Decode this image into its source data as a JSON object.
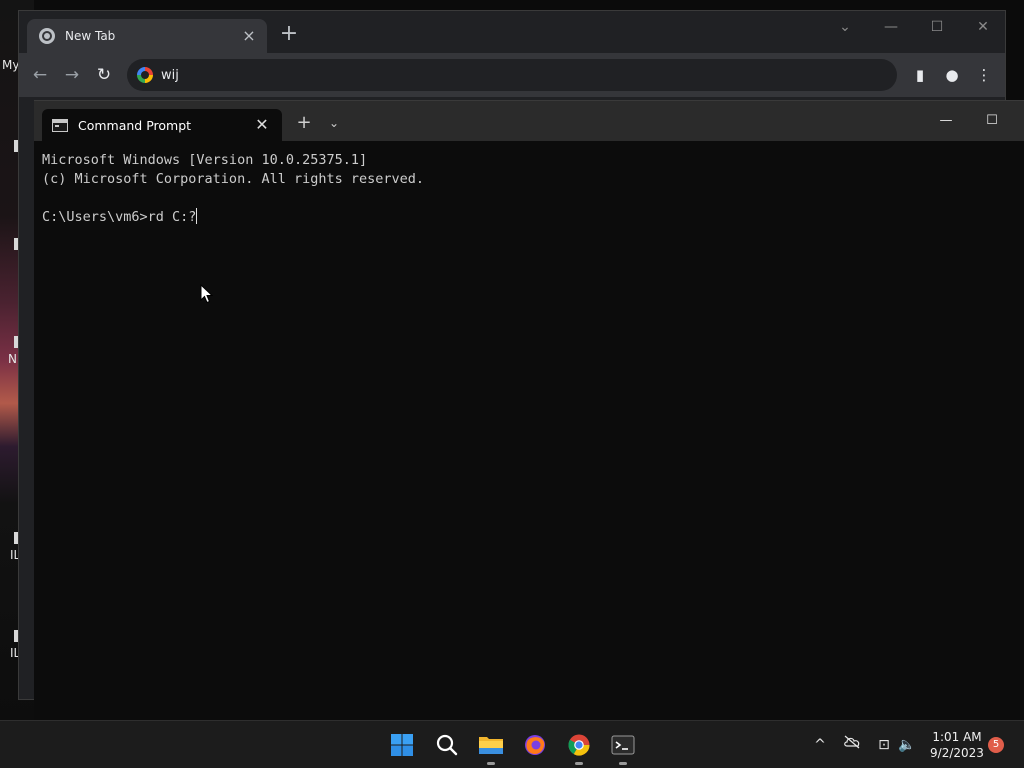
{
  "desktop": {
    "labels": [
      "My",
      "N",
      "IL",
      "IL"
    ]
  },
  "chrome": {
    "tab_title": "New Tab",
    "tab_close": "×",
    "new_tab": "+",
    "omnibox_text": "wij",
    "window_controls": {
      "tab_search": "⌄",
      "minimize": "—",
      "maximize": "☐",
      "close": "✕"
    },
    "toolbar": {
      "back": "←",
      "forward": "→",
      "reload": "↻",
      "side_panel": "▮",
      "profile": "●",
      "menu": "⋮"
    }
  },
  "terminal": {
    "tab_title": "Command Prompt",
    "tab_close": "✕",
    "new_tab": "+",
    "dropdown": "⌄",
    "window_controls": {
      "minimize": "—",
      "maximize": "☐"
    },
    "lines": [
      "Microsoft Windows [Version 10.0.25375.1]",
      "(c) Microsoft Corporation. All rights reserved.",
      "",
      "C:\\Users\\vm6>rd C:?"
    ]
  },
  "taskbar": {
    "apps": [
      {
        "name": "start",
        "icon": "windows-logo-icon"
      },
      {
        "name": "search",
        "icon": "search-icon"
      },
      {
        "name": "file-explorer",
        "icon": "folder-icon"
      },
      {
        "name": "firefox",
        "icon": "firefox-icon"
      },
      {
        "name": "chrome",
        "icon": "chrome-icon"
      },
      {
        "name": "terminal",
        "icon": "terminal-icon"
      }
    ],
    "tray": {
      "chevron": "^",
      "network": "⊡",
      "volume": "🔈"
    },
    "clock": {
      "time": "1:01 AM",
      "date": "9/2/2023"
    },
    "notification_count": "5"
  }
}
